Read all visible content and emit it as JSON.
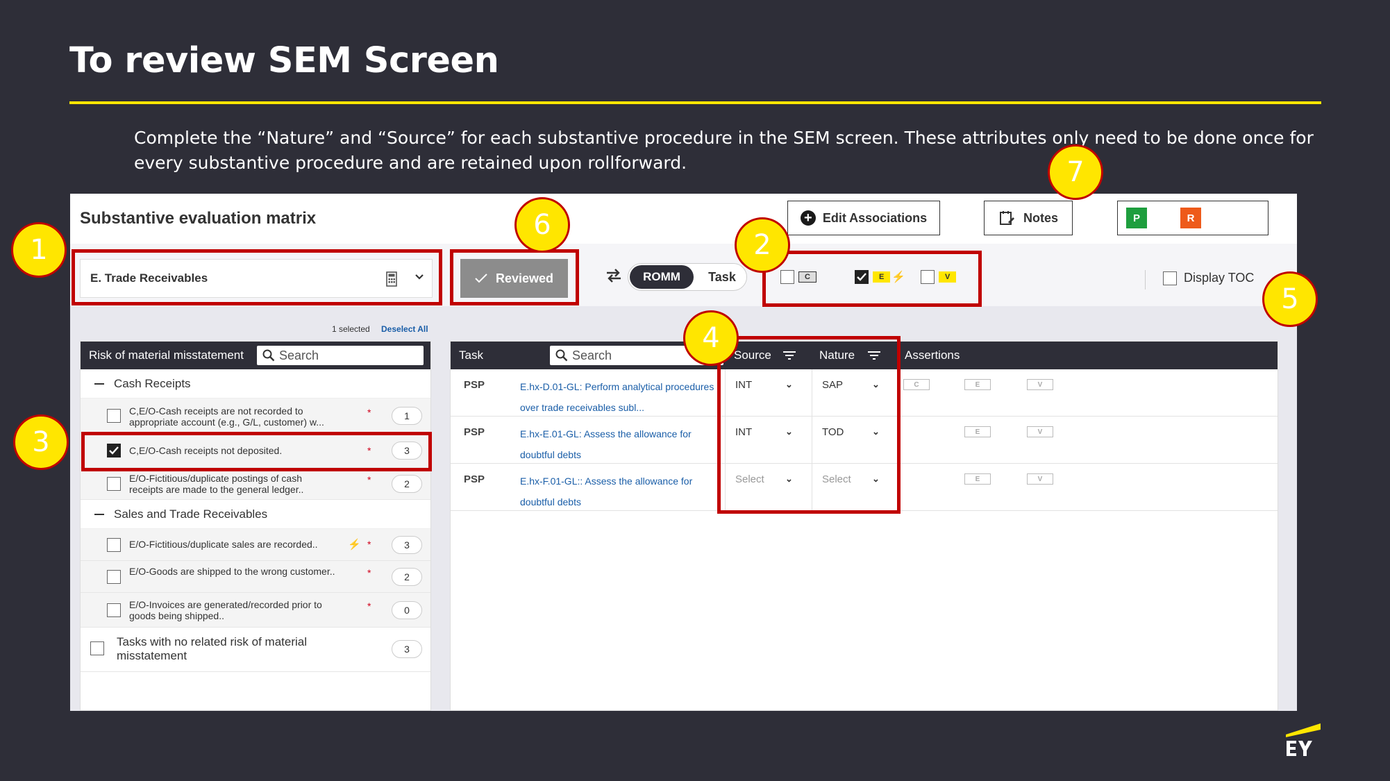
{
  "slide": {
    "title": "To review SEM Screen",
    "intro": "Complete the “Nature” and “Source” for each substantive procedure in the SEM screen. These attributes only need to be done once for every substantive procedure and are retained upon rollforward."
  },
  "header": {
    "matrix_title": "Substantive evaluation matrix",
    "edit_associations": "Edit Associations",
    "notes": "Notes",
    "p_badge": "P",
    "r_badge": "R"
  },
  "toolbar": {
    "account_dropdown": "E. Trade Receivables",
    "reviewed_button": "Reviewed",
    "toggle_romm": "ROMM",
    "toggle_task": "Task",
    "filter_c": "C",
    "filter_e": "E",
    "filter_v": "V",
    "display_toc": "Display TOC"
  },
  "left_panel": {
    "selected_info": "1 selected",
    "deselect_all": "Deselect All",
    "header": "Risk of material misstatement",
    "search_placeholder": "Search",
    "groups": [
      {
        "label": "Cash Receipts"
      },
      {
        "label": "Sales and Trade Receivables"
      }
    ],
    "risks": [
      {
        "text": "C,E/O-Cash receipts are not recorded to appropriate account (e.g., G/L, customer) w...",
        "count": "1",
        "checked": false
      },
      {
        "text": "C,E/O-Cash receipts not deposited.",
        "count": "3",
        "checked": true
      },
      {
        "text": "E/O-Fictitious/duplicate postings of cash receipts are made to the general ledger..",
        "count": "2",
        "checked": false
      },
      {
        "text": "E/O-Fictitious/duplicate sales are recorded..",
        "count": "3",
        "checked": false
      },
      {
        "text": "E/O-Goods are shipped to the wrong customer..",
        "count": "2",
        "checked": false
      },
      {
        "text": "E/O-Invoices are generated/recorded prior to goods being shipped..",
        "count": "0",
        "checked": false
      }
    ],
    "no_risk_row": {
      "text": "Tasks with no related risk of material misstatement",
      "count": "3"
    }
  },
  "right_panel": {
    "header_task": "Task",
    "search_placeholder": "Search",
    "header_source": "Source",
    "header_nature": "Nature",
    "header_assertions": "Assertions",
    "rows": [
      {
        "type": "PSP",
        "link": "E.hx-D.01-GL: Perform analytical procedures over trade receivables subl...",
        "source": "INT",
        "nature": "SAP",
        "assertions": [
          "C",
          "E",
          "V"
        ]
      },
      {
        "type": "PSP",
        "link": "E.hx-E.01-GL: Assess the allowance for doubtful debts",
        "source": "INT",
        "nature": "TOD",
        "assertions": [
          "E",
          "V"
        ]
      },
      {
        "type": "PSP",
        "link": "E.hx-F.01-GL:: Assess the allowance for doubtful debts",
        "source": "Select",
        "nature": "Select",
        "assertions": [
          "E",
          "V"
        ]
      }
    ]
  },
  "callouts": [
    "1",
    "2",
    "3",
    "4",
    "5",
    "6",
    "7"
  ],
  "colors": {
    "background": "#2e2e38",
    "accent_yellow": "#ffe600",
    "highlight_red": "#c00000",
    "p_badge": "#1e9e3e",
    "r_badge": "#ee5a1a",
    "link_blue": "#1a5ea8"
  },
  "logo": {
    "text": "EY"
  }
}
